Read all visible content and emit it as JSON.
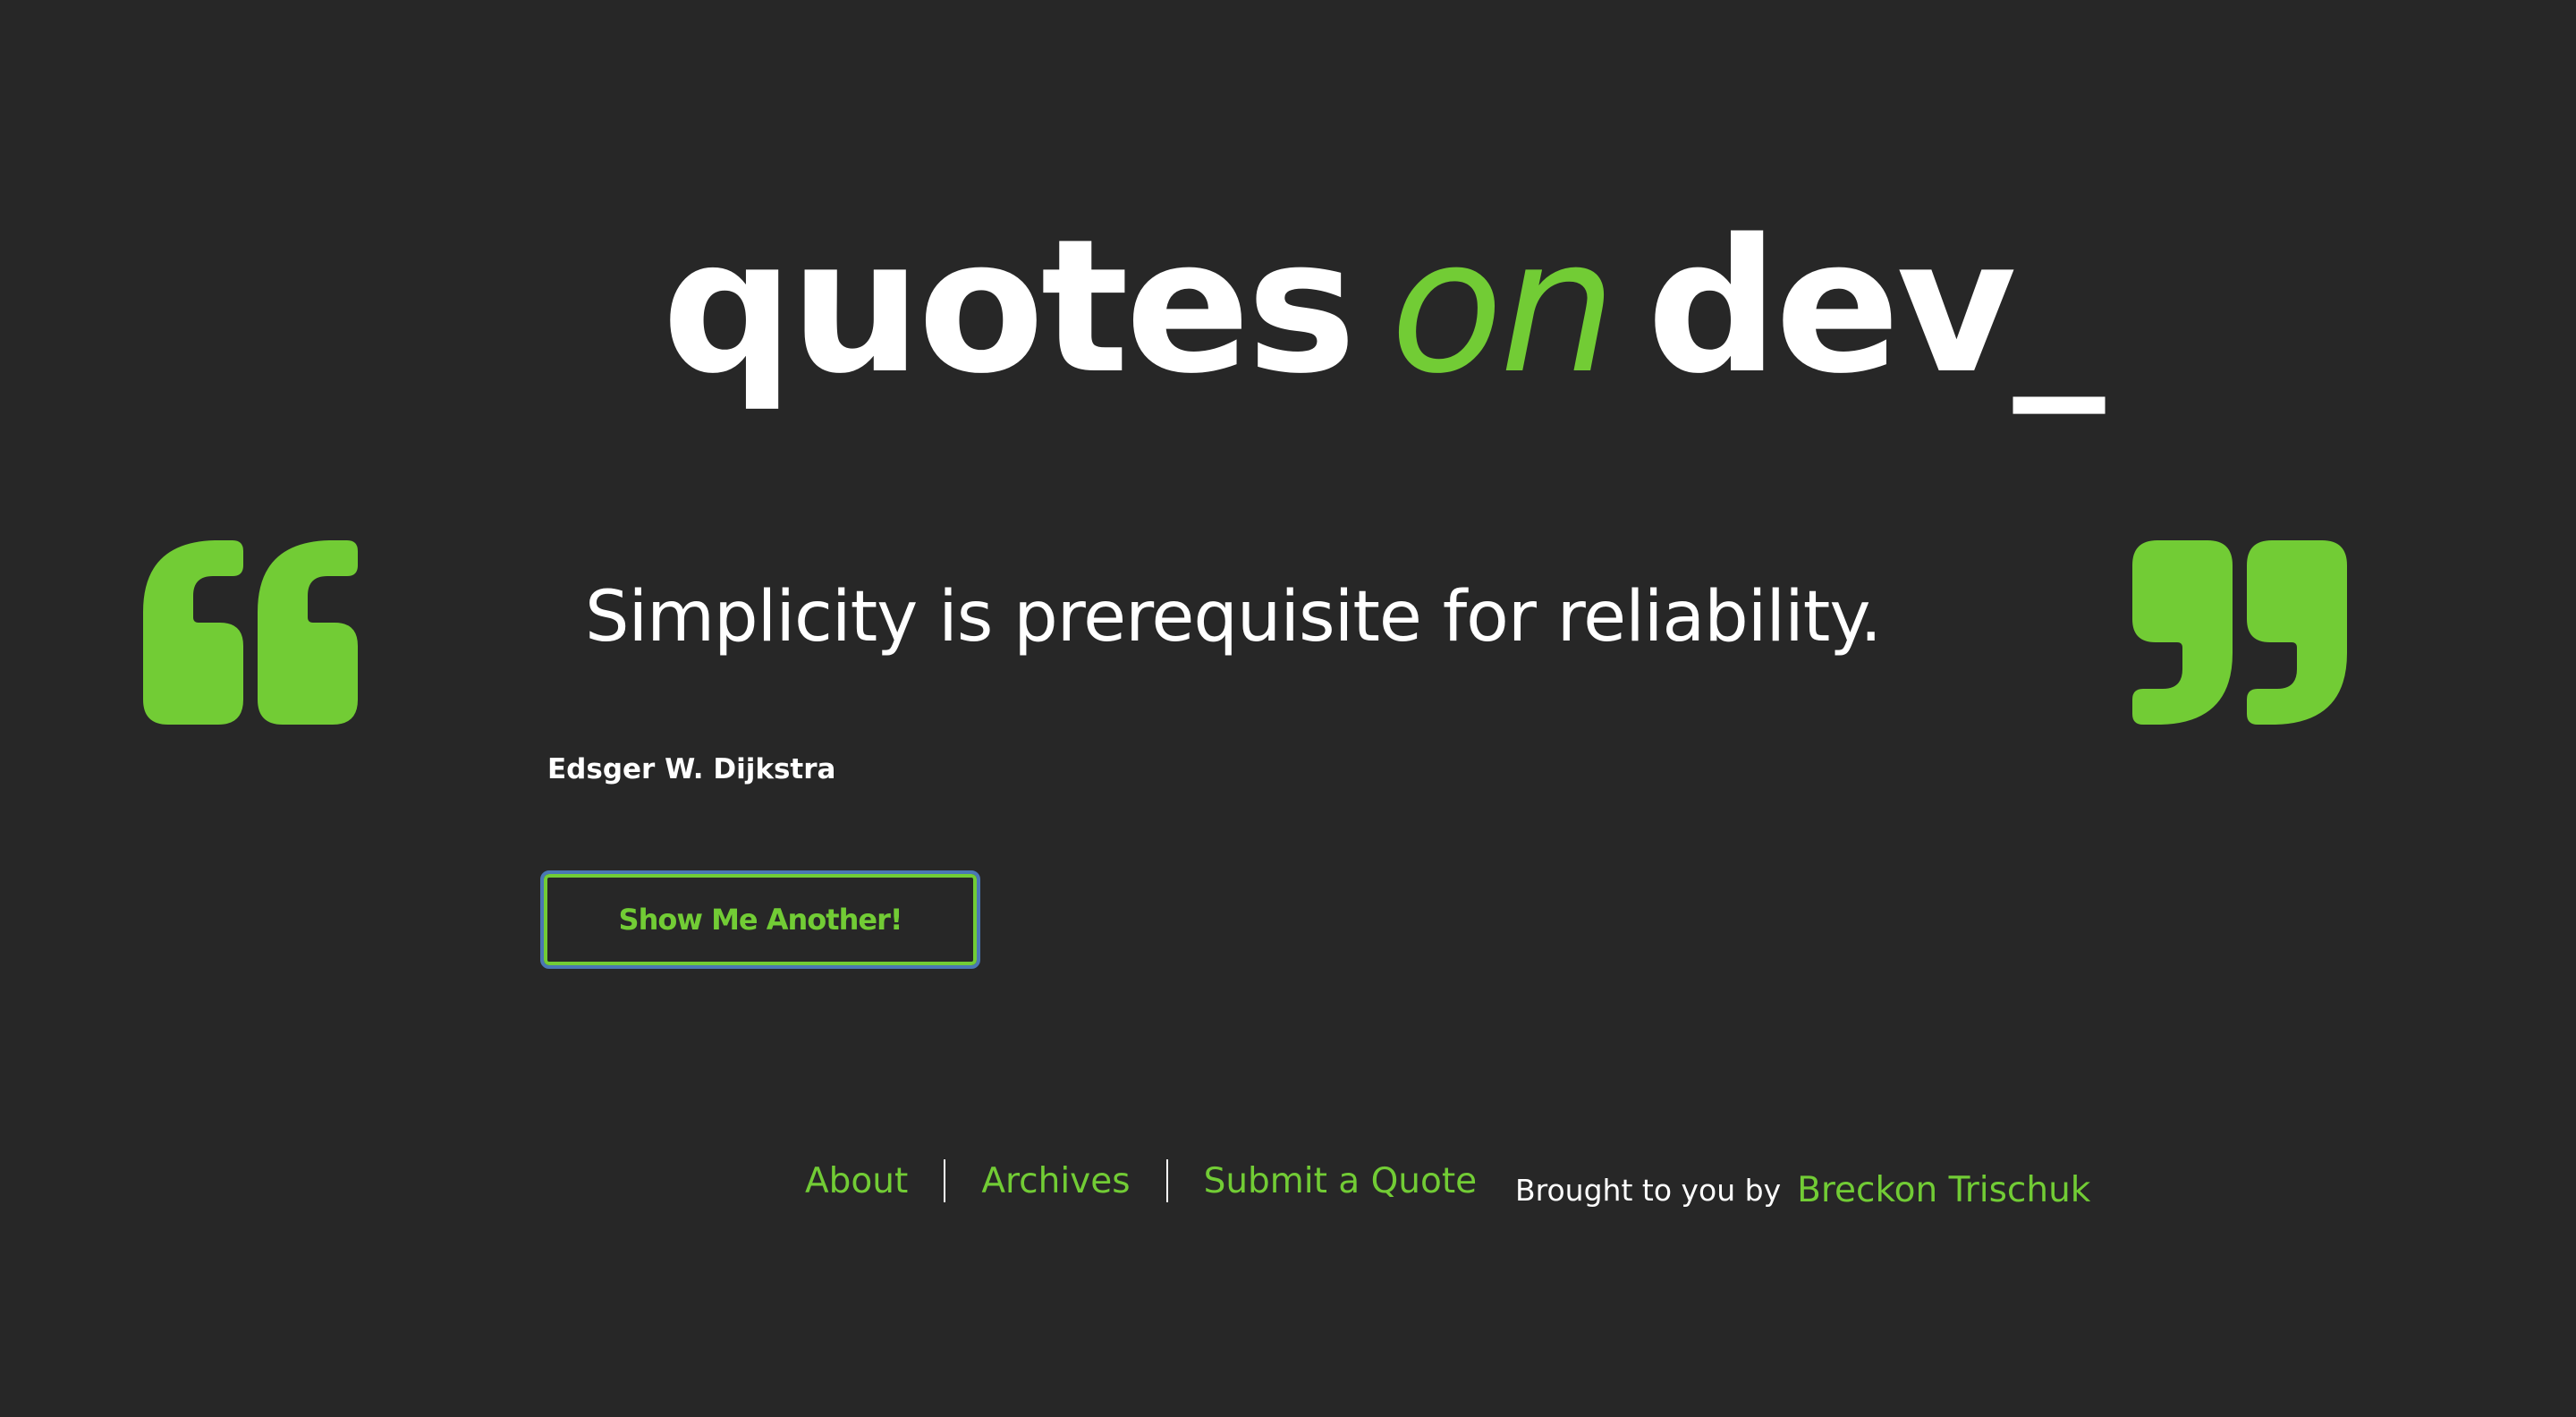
{
  "colors": {
    "background": "#272727",
    "accent": "#72cc35",
    "text": "#ffffff",
    "focus_ring": "#4a77b4"
  },
  "logo": {
    "word1": "quotes",
    "word2": "on",
    "word3": "dev_"
  },
  "icons": {
    "open_quote": "open-quote-icon",
    "close_quote": "close-quote-icon"
  },
  "quote": {
    "text": "Simplicity is prerequisite for reliability.",
    "author": "Edsger W. Dijkstra"
  },
  "button": {
    "label": "Show Me Another!"
  },
  "footer": {
    "nav": [
      "About",
      "Archives",
      "Submit a Quote"
    ],
    "credit_prefix": "Brought to you by",
    "credit_name": "Breckon Trischuk"
  }
}
